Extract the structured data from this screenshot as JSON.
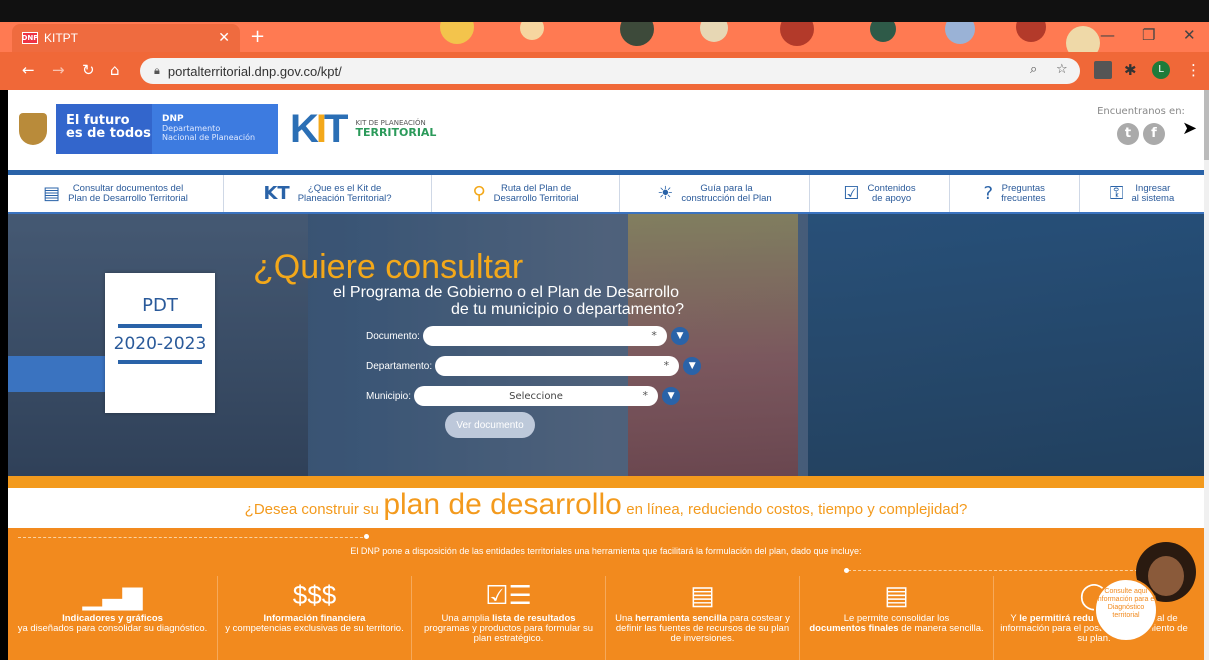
{
  "browser": {
    "tab_title": "KITPT",
    "tab_favicon": "DNP",
    "url": "portalterritorial.dnp.gov.co/kpt/",
    "profile_initial": "L"
  },
  "header": {
    "gov_line1": "El futuro",
    "gov_line2": "es de todos",
    "dnp_short": "DNP",
    "dnp_line1": "Departamento",
    "dnp_line2": "Nacional de Planeación",
    "kit_sub": "KIT DE PLANEACIÓN",
    "kit_main": "TERRITORIAL",
    "social_label": "Encuentranos en:"
  },
  "nav": {
    "items": [
      {
        "l1": "Consultar documentos del",
        "l2": "Plan de Desarrollo Territorial"
      },
      {
        "l1": "¿Que es el Kit de",
        "l2": "Planeación Territorial?"
      },
      {
        "l1": "Ruta del Plan de",
        "l2": "Desarrollo Territorial"
      },
      {
        "l1": "Guía para la",
        "l2": "construcción del Plan"
      },
      {
        "l1": "Contenidos",
        "l2": "de apoyo"
      },
      {
        "l1": "Preguntas",
        "l2": "frecuentes"
      },
      {
        "l1": "Ingresar",
        "l2": "al sistema"
      }
    ]
  },
  "hero": {
    "pdt": "PDT",
    "years": "2020-2023",
    "q1": "¿Quiere consultar",
    "q2": "el Programa de Gobierno o el Plan de Desarrollo",
    "q3": "de tu municipio o departamento?",
    "doc_label": "Documento:",
    "dep_label": "Departamento:",
    "mun_label": "Municipio:",
    "mun_value": "Seleccione",
    "button": "Ver documento"
  },
  "construir": {
    "pre": "¿Desea construir su",
    "big": "plan de desarrollo",
    "post": "en línea, reduciendo costos, tiempo y complejidad?"
  },
  "orange": {
    "intro": "El DNP pone a disposición de las entidades territoriales una herramienta que facilitará la formulación del plan, dado que incluye:",
    "features": [
      {
        "b": "Indicadores y gráficos",
        "t": "ya diseñados para consolidar su diagnóstico."
      },
      {
        "b": "Información financiera",
        "t": "y competencias exclusivas de su territorio."
      },
      {
        "pre": "Una amplia",
        "b": "lista de resultados",
        "t": "programas y productos para formular su plan estratégico."
      },
      {
        "pre": "Una",
        "b": "herramienta sencilla",
        "t": "para costear y definir las fuentes de recursos de su plan de inversiones."
      },
      {
        "pre": "Le permite consolidar los",
        "b": "documentos finales",
        "t": "de manera sencilla."
      },
      {
        "pre": "Y",
        "b": "le permitirá redu",
        "t": "el registro inicial de información para el posterior seguimiento de su plan."
      }
    ],
    "consulte": "Consulte aquí información para el Diagnóstico territorial"
  }
}
